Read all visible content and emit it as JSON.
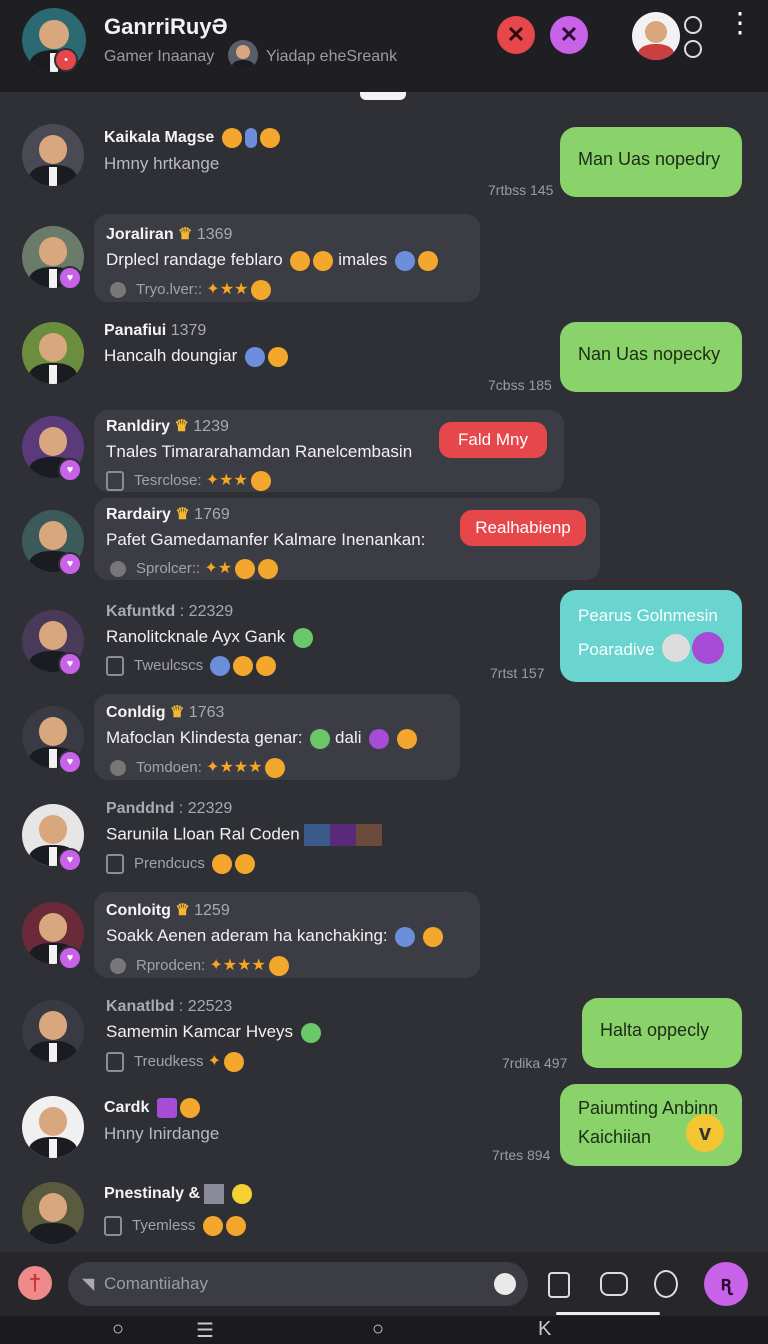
{
  "header": {
    "title": "GanrriRuyƏ",
    "subtitle": "Gamer Inaanay",
    "subtitle2": "Yiadap eheSreank"
  },
  "messages_left": [
    {
      "name": "Kaikala Magse",
      "text": "Hmny hrtkange"
    },
    {
      "name": "Joraliran",
      "num": "1369",
      "text": "Drplecl randage feblaro",
      "extra": "imales",
      "meta": "Tryo.lver::"
    },
    {
      "name": "Panafiui",
      "num": "1379",
      "text": "Hancalh doungiar"
    },
    {
      "name": "Ranldiry",
      "num": "1239",
      "text": "Tnales Timararahamdan Ranelcembasin",
      "meta": "Tesrclose:",
      "button": "Fald Mny"
    },
    {
      "name": "Rardairy",
      "num": "1769",
      "text": "Pafet Gamedamanfer Kalmare Inenankan:",
      "meta": "Sprolcer::",
      "button": "Realhabienp"
    },
    {
      "name": "Kafuntkd",
      "num": ": 22329",
      "text": "Ranolitcknale Ayx Gank",
      "meta": "Tweulcscs"
    },
    {
      "name": "Conldig",
      "num": "1763",
      "text": "Mafoclan Klindesta genar:",
      "extra": "dali",
      "meta": "Tomdoen:"
    },
    {
      "name": "Panddnd",
      "num": ": 22329",
      "text": "Sarunila Lloan Ral Coden",
      "meta": "Prendcucs"
    },
    {
      "name": "Conloitg",
      "num": "1259",
      "text": "Soakk Aenen aderam ha kanchaking:",
      "meta": "Rprodcen:"
    },
    {
      "name": "Kanatlbd",
      "num": ": 22523",
      "text": "Samemin Kamcar Hveys",
      "meta": "Treudkess"
    },
    {
      "name": "Cardk",
      "text": "Hnny Inirdange"
    },
    {
      "name": "Pnestinaly &",
      "meta": "Tyemless"
    }
  ],
  "messages_right": [
    {
      "text": "Man Uas nopedry",
      "time": "7rtbss 145"
    },
    {
      "text": "Nan Uas nopecky",
      "time": "7cbss 185"
    },
    {
      "text1": "Pearus Golnmesin",
      "text2": "Poaradive",
      "time": "7rtst 157"
    },
    {
      "text": "Halta oppecly",
      "time": "7rdika 497"
    },
    {
      "text1": "Paiumting Anbinn",
      "text2": "Kaichiian",
      "time": "7rtes 894"
    }
  ],
  "compose": {
    "placeholder": "Comantiiahay"
  },
  "colors": {
    "bg": "#2f3035",
    "header": "#1f1f23",
    "green_bubble": "#8ad26a",
    "teal_bubble": "#6ad4cf",
    "red": "#e6474b",
    "accent": "#c862e8"
  },
  "icons": [
    "close-icon",
    "more-vert-icon",
    "camera-icon",
    "mic-icon",
    "send-icon",
    "chevron-down-icon"
  ]
}
